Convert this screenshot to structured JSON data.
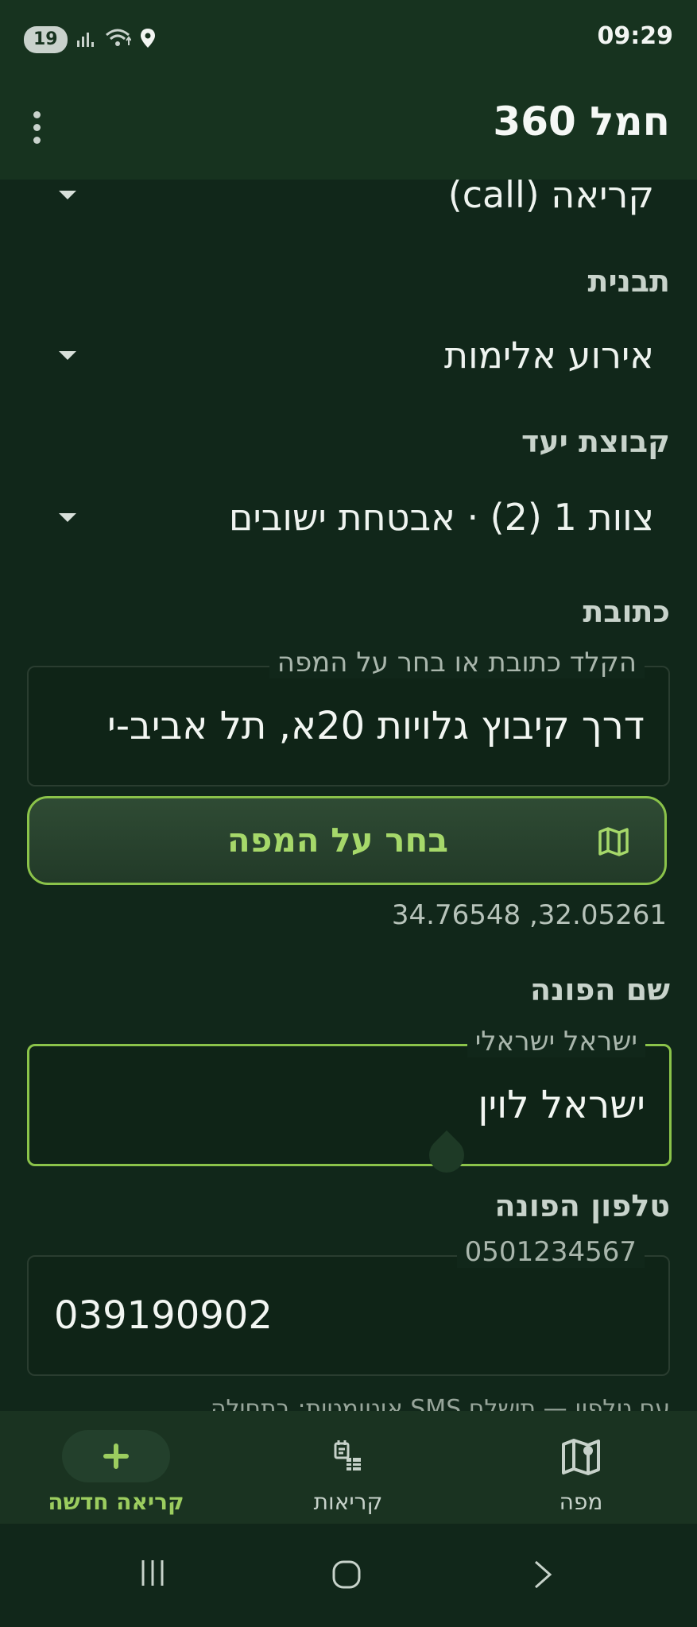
{
  "status_bar": {
    "notification_count": "19",
    "time": "09:29",
    "icons": [
      "signal-icon",
      "wifi-icon",
      "location-icon"
    ]
  },
  "app_bar": {
    "title": "חמל 360",
    "menu_icon": "more-vert-icon"
  },
  "form": {
    "type_value": "קריאה (call)",
    "template_label": "תבנית",
    "template_value": "אירוע אלימות",
    "target_group_label": "קבוצת יעד",
    "target_group_value": "צוות 1 (2) · אבטחת ישובים",
    "address_label": "כתובת",
    "address_placeholder": "הקלד כתובת או בחר על המפה",
    "address_value": "דרך קיבוץ גלויות 20א, תל אביב-י",
    "map_button_label": "בחר על המפה",
    "map_button_icon": "map-icon",
    "coordinates": "34.76548 ,32.05261",
    "caller_name_label": "שם הפונה",
    "caller_name_placeholder": "ישראל ישראלי",
    "caller_name_value": "ישראל לוין",
    "caller_phone_label": "טלפון הפונה",
    "caller_phone_placeholder": "0501234567",
    "caller_phone_value": "039190902",
    "sms_note": "עם טלפון — תישלח SMS אוטומטית: בתחילה"
  },
  "bottom_nav": {
    "items": [
      {
        "label": "קריאה חדשה",
        "icon": "add-icon",
        "active": true
      },
      {
        "label": "קריאות",
        "icon": "calls-icon",
        "active": false
      },
      {
        "label": "מפה",
        "icon": "map-icon",
        "active": false
      }
    ]
  },
  "colors": {
    "background": "#11271a",
    "app_bar": "#17331f",
    "accent": "#8bc34a"
  }
}
